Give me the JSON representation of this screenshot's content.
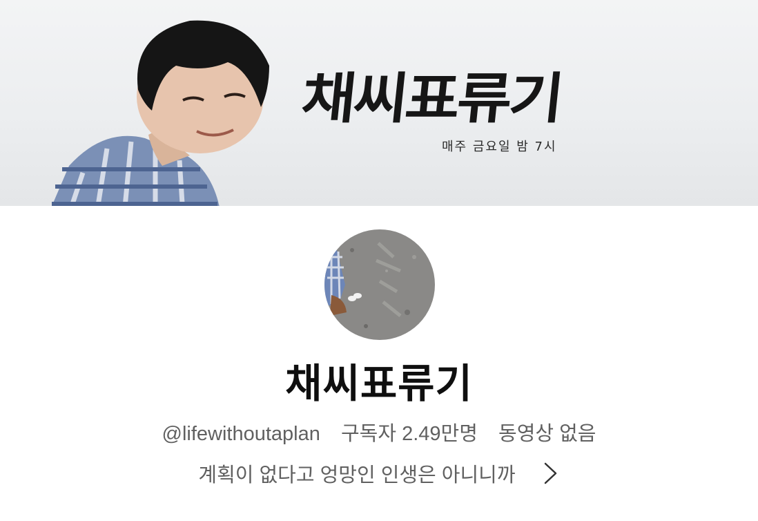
{
  "banner": {
    "title": "채씨표류기",
    "subtitle": "매주 금요일 밤 7시"
  },
  "channel": {
    "name": "채씨표류기",
    "handle": "@lifewithoutaplan",
    "subscribers": "구독자 2.49만명",
    "videos": "동영상 없음",
    "description": "계획이 없다고 엉망인 인생은 아니니까"
  },
  "icons": {
    "more": "chevron-right-icon"
  }
}
